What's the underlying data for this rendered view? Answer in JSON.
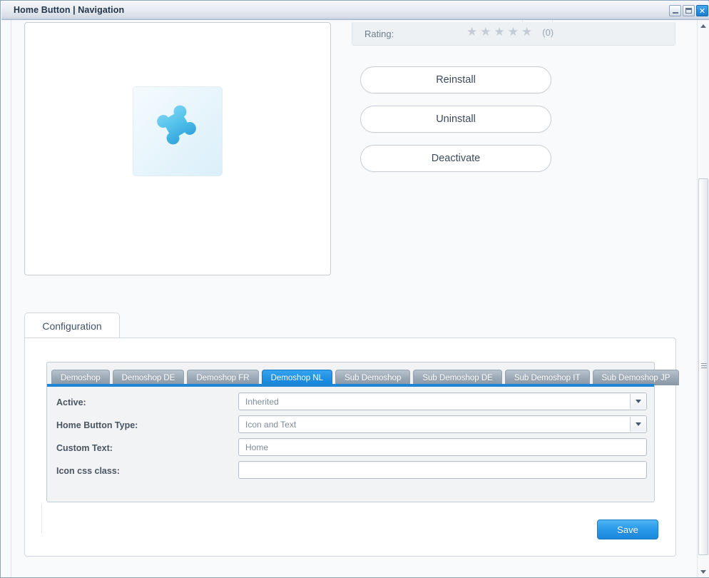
{
  "window": {
    "title": "Home Button | Navigation",
    "controls": {
      "minimize": "minimize",
      "maximize": "maximize",
      "close": "✕"
    }
  },
  "detail": {
    "rating": {
      "label": "Rating:",
      "stars": [
        "★",
        "★",
        "★",
        "★",
        "★"
      ],
      "filled": 0,
      "count": "(0)"
    },
    "actions": [
      {
        "label": "Reinstall"
      },
      {
        "label": "Uninstall"
      },
      {
        "label": "Deactivate"
      }
    ],
    "plugin_icon": "puzzle-piece-icon"
  },
  "configuration": {
    "tab_label": "Configuration",
    "shop_tabs": [
      {
        "label": "Demoshop",
        "active": false
      },
      {
        "label": "Demoshop DE",
        "active": false
      },
      {
        "label": "Demoshop FR",
        "active": false
      },
      {
        "label": "Demoshop NL",
        "active": true
      },
      {
        "label": "Sub Demoshop",
        "active": false
      },
      {
        "label": "Sub Demoshop DE",
        "active": false
      },
      {
        "label": "Sub Demoshop IT",
        "active": false
      },
      {
        "label": "Sub Demoshop JP",
        "active": false
      }
    ],
    "fields": [
      {
        "label": "Active:",
        "value": "Inherited",
        "type": "select"
      },
      {
        "label": "Home Button Type:",
        "value": "Icon and Text",
        "type": "select"
      },
      {
        "label": "Custom Text:",
        "value": "Home",
        "type": "text"
      },
      {
        "label": "Icon css class:",
        "value": "",
        "type": "text"
      }
    ],
    "save_label": "Save"
  },
  "colors": {
    "accent_blue": "#1f90e2",
    "tab_inactive": "#9aa8b5",
    "star_gray": "#c3ccd4",
    "title_text": "#23344a"
  }
}
